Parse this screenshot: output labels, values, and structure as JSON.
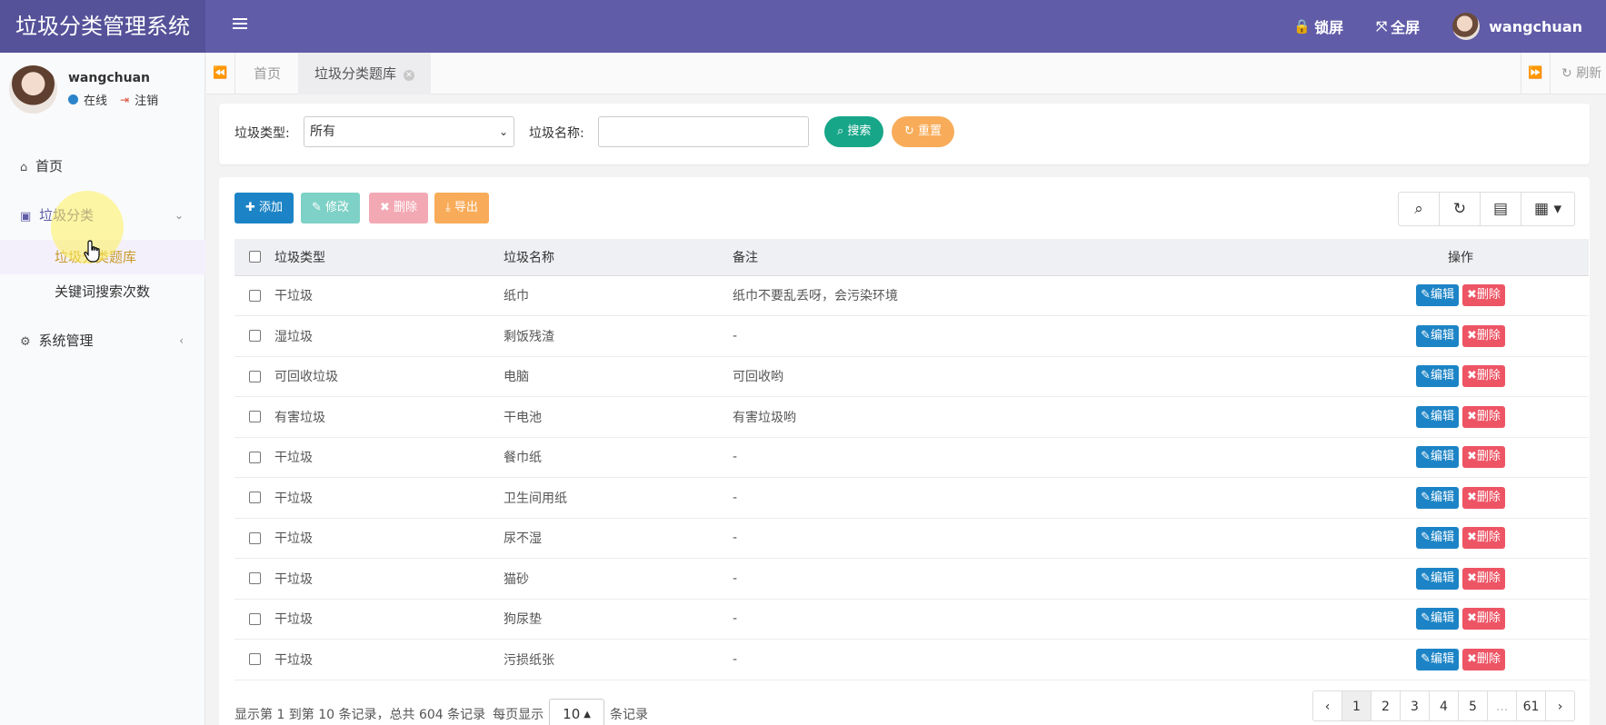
{
  "app": {
    "title": "垃圾分类管理系统"
  },
  "header": {
    "lock_label": "锁屏",
    "fullscreen_label": "全屏",
    "username": "wangchuan"
  },
  "sidebar": {
    "user": {
      "name": "wangchuan",
      "status": "在线",
      "logout": "注销"
    },
    "items": [
      {
        "label": "首页"
      },
      {
        "label": "垃圾分类",
        "children": [
          {
            "label": "垃圾分类题库"
          },
          {
            "label": "关键词搜索次数"
          }
        ]
      },
      {
        "label": "系统管理"
      }
    ]
  },
  "tabs": {
    "home": "首页",
    "active": "垃圾分类题库",
    "refresh": "刷新"
  },
  "search": {
    "type_label": "垃圾类型:",
    "type_value": "所有",
    "name_label": "垃圾名称:",
    "name_value": "",
    "search_btn": "搜索",
    "reset_btn": "重置"
  },
  "toolbar": {
    "add": "添加",
    "edit": "修改",
    "delete": "删除",
    "export": "导出"
  },
  "table": {
    "headers": {
      "type": "垃圾类型",
      "name": "垃圾名称",
      "note": "备注",
      "op": "操作"
    },
    "edit_label": "编辑",
    "delete_label": "删除",
    "rows": [
      {
        "type": "干垃圾",
        "name": "纸巾",
        "note": "纸巾不要乱丢呀，会污染环境"
      },
      {
        "type": "湿垃圾",
        "name": "剩饭残渣",
        "note": "-"
      },
      {
        "type": "可回收垃圾",
        "name": "电脑",
        "note": "可回收哟"
      },
      {
        "type": "有害垃圾",
        "name": "干电池",
        "note": "有害垃圾哟"
      },
      {
        "type": "干垃圾",
        "name": "餐巾纸",
        "note": "-"
      },
      {
        "type": "干垃圾",
        "name": "卫生间用纸",
        "note": "-"
      },
      {
        "type": "干垃圾",
        "name": "尿不湿",
        "note": "-"
      },
      {
        "type": "干垃圾",
        "name": "猫砂",
        "note": "-"
      },
      {
        "type": "干垃圾",
        "name": "狗尿垫",
        "note": "-"
      },
      {
        "type": "干垃圾",
        "name": "污损纸张",
        "note": "-"
      }
    ]
  },
  "pagination": {
    "summary": "显示第 1 到第 10 条记录，总共 604 条记录",
    "per_page_label": "每页显示",
    "page_size": "10",
    "per_page_suffix": "条记录",
    "prev": "‹",
    "pages": [
      "1",
      "2",
      "3",
      "4",
      "5"
    ],
    "ellipsis": "...",
    "last": "61",
    "next": "›"
  }
}
